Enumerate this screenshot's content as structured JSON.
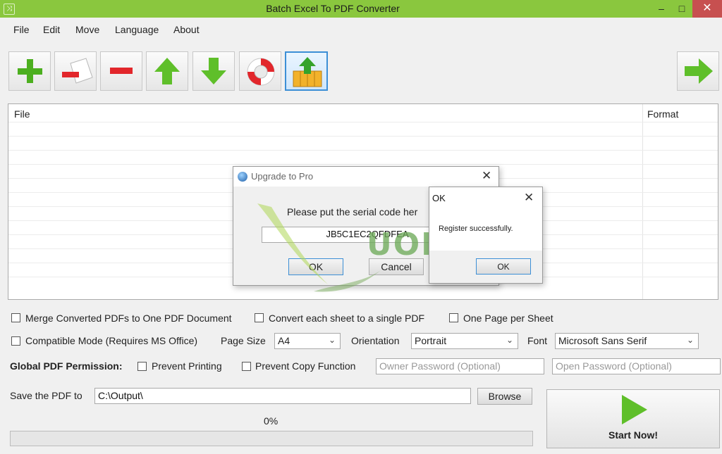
{
  "window": {
    "title": "Batch Excel To PDF Converter",
    "min_symbol": "–",
    "max_symbol": "□",
    "close_symbol": "✕"
  },
  "menu": [
    "File",
    "Edit",
    "Move",
    "Language",
    "About"
  ],
  "toolbar": {
    "buttons": [
      "add-files-icon",
      "remove-file-icon",
      "remove-all-icon",
      "move-up-icon",
      "move-down-icon",
      "help-lifebuoy-icon",
      "upgrade-basket-icon"
    ],
    "next_button": "next-arrow-icon"
  },
  "file_list": {
    "columns": [
      "File",
      "Format"
    ],
    "rows": []
  },
  "options": {
    "merge": {
      "label": "Merge Converted PDFs to One PDF Document",
      "checked": false
    },
    "each_sheet": {
      "label": "Convert each sheet to a single PDF",
      "checked": false
    },
    "one_page": {
      "label": "One Page per Sheet",
      "checked": false
    },
    "compatible": {
      "label": "Compatible Mode (Requires MS Office)",
      "checked": false
    },
    "page_size_label": "Page Size",
    "page_size_value": "A4",
    "orientation_label": "Orientation",
    "orientation_value": "Portrait",
    "font_label": "Font",
    "font_value": "Microsoft Sans Serif",
    "permission_label": "Global PDF Permission:",
    "prevent_printing": {
      "label": "Prevent Printing",
      "checked": false
    },
    "prevent_copy": {
      "label": "Prevent Copy Function",
      "checked": false
    },
    "owner_password_placeholder": "Owner Password (Optional)",
    "open_password_placeholder": "Open Password (Optional)"
  },
  "output": {
    "label": "Save the PDF to",
    "path": "C:\\Output\\",
    "browse_label": "Browse"
  },
  "progress": {
    "text": "0%",
    "value": 0
  },
  "start": {
    "label": "Start Now!"
  },
  "upgrade_dialog": {
    "title": "Upgrade to Pro",
    "prompt": "Please put the serial code her",
    "serial": "JB5C1EC2QFDFEA",
    "ok_label": "OK",
    "cancel_label": "Cancel"
  },
  "ok_dialog": {
    "title": "OK",
    "message": "Register successfully.",
    "ok_label": "OK"
  },
  "watermark": {
    "text": "UOFFERS"
  },
  "colors": {
    "title_bar": "#8ac73e",
    "close_button": "#c75050",
    "accent_blue": "#3c8fd6",
    "green_icon": "#4caf1f"
  }
}
